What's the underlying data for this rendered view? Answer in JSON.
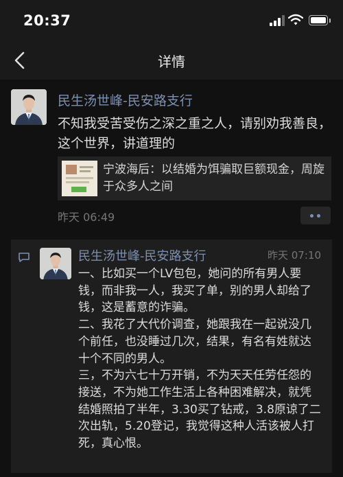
{
  "status_bar": {
    "time": "20:37"
  },
  "nav": {
    "title": "详情"
  },
  "post": {
    "author": "民生汤世峰-民安路支行",
    "text": "不知我受苦受伤之深之重之人，请别劝我善良，这个世界，讲道理的",
    "link": {
      "title": "宁波海后：以结婚为饵骗取巨额现金，周旋于众多人之间"
    },
    "time": "昨天 06:49"
  },
  "comment": {
    "author": "民生汤世峰-民安路支行",
    "time": "昨天 07:10",
    "text": "一、比如买一个LV包包，她问的所有男人要钱，而非我一人，我买了单，别的男人却给了钱，这是蓄意的诈骗。\n二、我花了大代价调查，她跟我在一起说没几个前任，也没睡过几次，结果，有名有姓就达十个不同的男人。\n三，不为六七十万开销，不为天天任劳任怨的接送，不为她工作生活上各种困难解决，就凭结婚照拍了半年，3.30买了钻戒，3.8原谅了二次出轨，5.20登记，我觉得这种人活该被人打死，真心恨。"
  },
  "icons": [
    "back-icon",
    "signal-icon",
    "wifi-icon",
    "battery-icon",
    "more-icon",
    "comment-icon"
  ],
  "colors": {
    "background": "#111111",
    "author_link": "#7d90b2",
    "text": "#dcdcdc",
    "muted": "#767676"
  }
}
